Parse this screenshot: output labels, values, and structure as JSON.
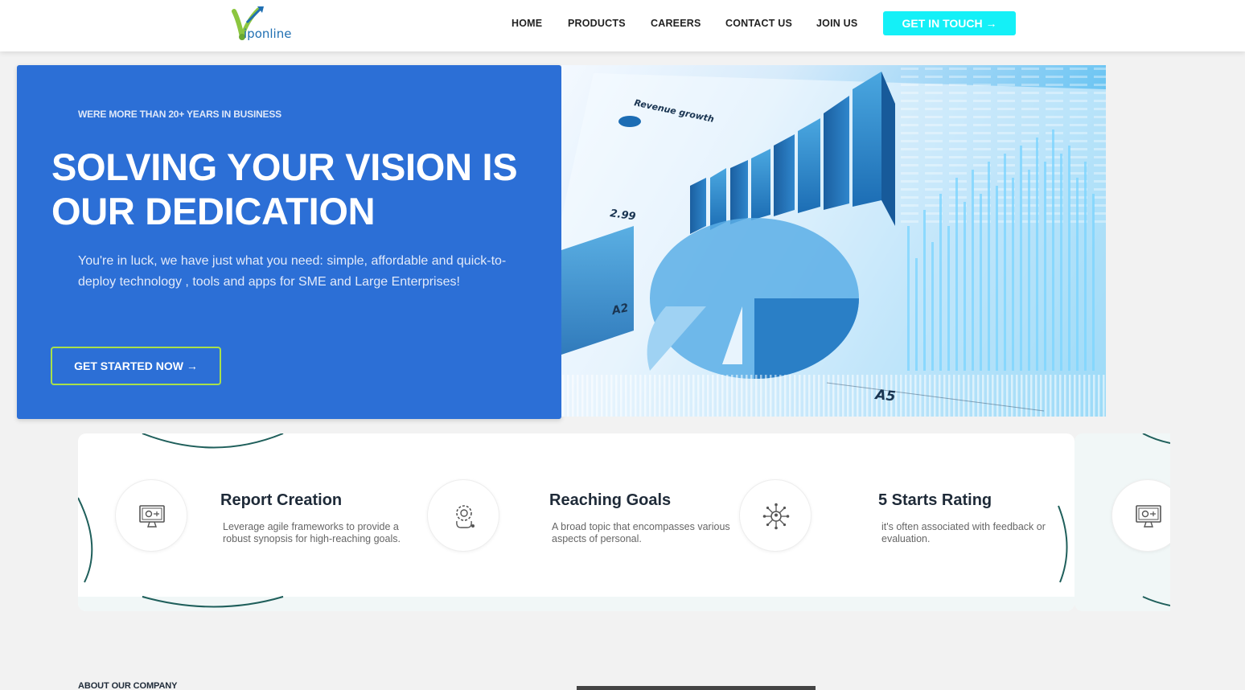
{
  "header": {
    "logo_text": "iponline",
    "nav": [
      {
        "label": "HOME"
      },
      {
        "label": "PRODUCTS"
      },
      {
        "label": "CAREERS"
      },
      {
        "label": "CONTACT US"
      },
      {
        "label": "JOIN US"
      }
    ],
    "cta_label": "GET IN TOUCH →"
  },
  "hero": {
    "eyebrow": "WERE MORE THAN 20+ YEARS IN BUSINESS",
    "title": "SOLVING YOUR VISION IS OUR DEDICATION",
    "description": "You're in luck, we have just what you need: simple, affordable and quick-to-deploy technology , tools and apps for SME and Large Enterprises!",
    "button_label": "GET STARTED NOW →",
    "image": {
      "caption": "Revenue growth",
      "labels": [
        "2.99",
        "A2",
        "A5"
      ]
    }
  },
  "features": [
    {
      "icon": "monitor-settings-icon",
      "title": "Report Creation",
      "text": "Leverage agile frameworks to provide a robust synopsis for high-reaching goals."
    },
    {
      "icon": "gear-head-icon",
      "title": "Reaching Goals",
      "text": "A broad topic that encompasses various aspects of personal."
    },
    {
      "icon": "network-person-icon",
      "title": "5 Starts Rating",
      "text": "it's often associated with feedback or evaluation."
    }
  ],
  "about": {
    "label": "ABOUT OUR COMPANY"
  },
  "colors": {
    "primary_blue": "#2c6fd6",
    "cta_cyan": "#14f0f7",
    "button_border": "#a8e04a",
    "wave_teal": "#1f5f5b"
  }
}
